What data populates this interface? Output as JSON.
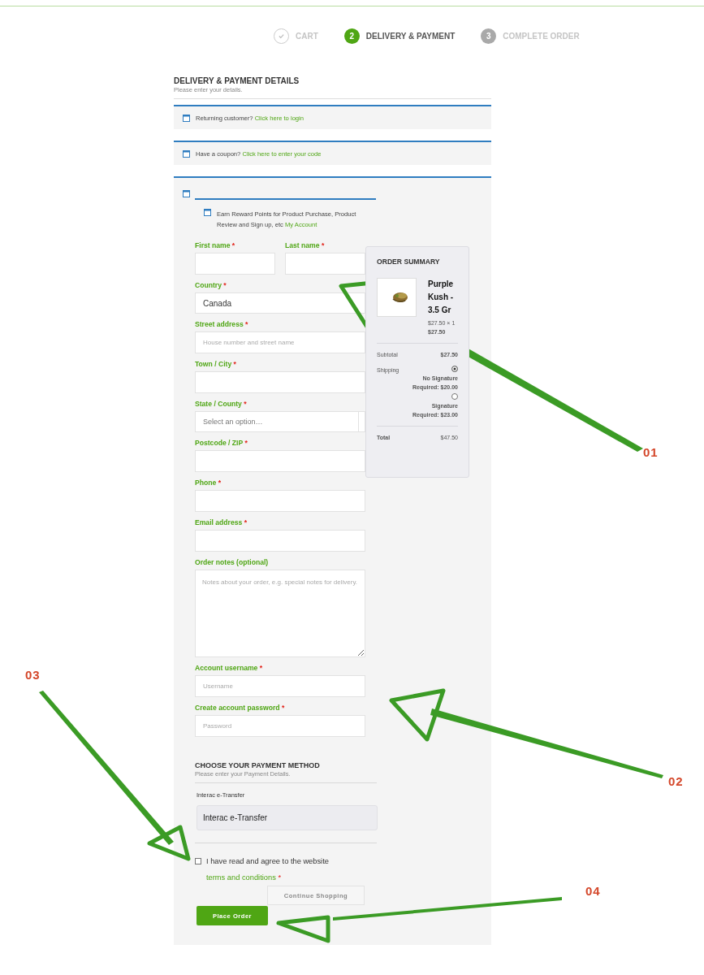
{
  "steps": [
    {
      "kind": "done",
      "label": "CART"
    },
    {
      "kind": "current",
      "number": "2",
      "label": "DELIVERY & PAYMENT"
    },
    {
      "kind": "upcoming",
      "number": "3",
      "label": "COMPLETE ORDER"
    }
  ],
  "header": {
    "title": "DELIVERY & PAYMENT DETAILS",
    "subtitle": "Please enter your details."
  },
  "notices": [
    {
      "text": "Returning customer?",
      "link": "Click here to login"
    },
    {
      "text": "Have a coupon?",
      "link": "Click here to enter your code"
    }
  ],
  "reward": {
    "text": "Earn Reward Points for Product Purchase, Product Review and Sign up, etc",
    "link": "My Account"
  },
  "required_mark": "*",
  "fields": [
    {
      "kind": "pair",
      "fields": [
        {
          "kind": "input",
          "label": "First name",
          "required": true
        },
        {
          "kind": "input",
          "label": "Last name",
          "required": true
        }
      ]
    },
    {
      "kind": "select-value",
      "label": "Country",
      "required": true,
      "value": "Canada"
    },
    {
      "kind": "input",
      "label": "Street address",
      "required": true,
      "placeholder": "House number and street name"
    },
    {
      "kind": "input",
      "label": "Town / City",
      "required": true
    },
    {
      "kind": "select",
      "label": "State / County",
      "required": true,
      "placeholder": "Select an option…"
    },
    {
      "kind": "input",
      "label": "Postcode / ZIP",
      "required": true
    },
    {
      "kind": "input",
      "label": "Phone",
      "required": true
    },
    {
      "kind": "input",
      "label": "Email address",
      "required": true
    },
    {
      "kind": "textarea",
      "label": "Order notes (optional)",
      "required": false,
      "placeholder": "Notes about your order, e.g. special notes for delivery."
    },
    {
      "kind": "input",
      "label": "Account username",
      "required": true,
      "placeholder": "Username"
    },
    {
      "kind": "input",
      "label": "Create account password",
      "required": true,
      "placeholder": "Password"
    }
  ],
  "order_summary": {
    "title": "ORDER SUMMARY",
    "product": {
      "name": "Purple Kush - 3.5 Gr",
      "price": "$27.50 × 1",
      "line_total": "$27.50"
    },
    "subtotal_label": "Subtotal",
    "subtotal": "$27.50",
    "shipping_label": "Shipping",
    "shipping_options": [
      {
        "label": "No Signature Required: $20.00",
        "selected": true
      },
      {
        "label": "Signature Required: $23.00",
        "selected": false
      }
    ],
    "total_label": "Total",
    "total": "$47.50"
  },
  "payment": {
    "title": "CHOOSE YOUR PAYMENT METHOD",
    "subtitle": "Please enter your Payment Details.",
    "method_label": "Interac e-Transfer",
    "method": "Interac e-Transfer"
  },
  "terms": {
    "checked": false,
    "text": "I have read and agree to the website",
    "link": "terms and conditions"
  },
  "buttons": {
    "continue": "Continue Shopping",
    "place": "Place Order"
  },
  "annotations": [
    {
      "label": "01"
    },
    {
      "label": "02"
    },
    {
      "label": "03"
    },
    {
      "label": "04"
    }
  ]
}
